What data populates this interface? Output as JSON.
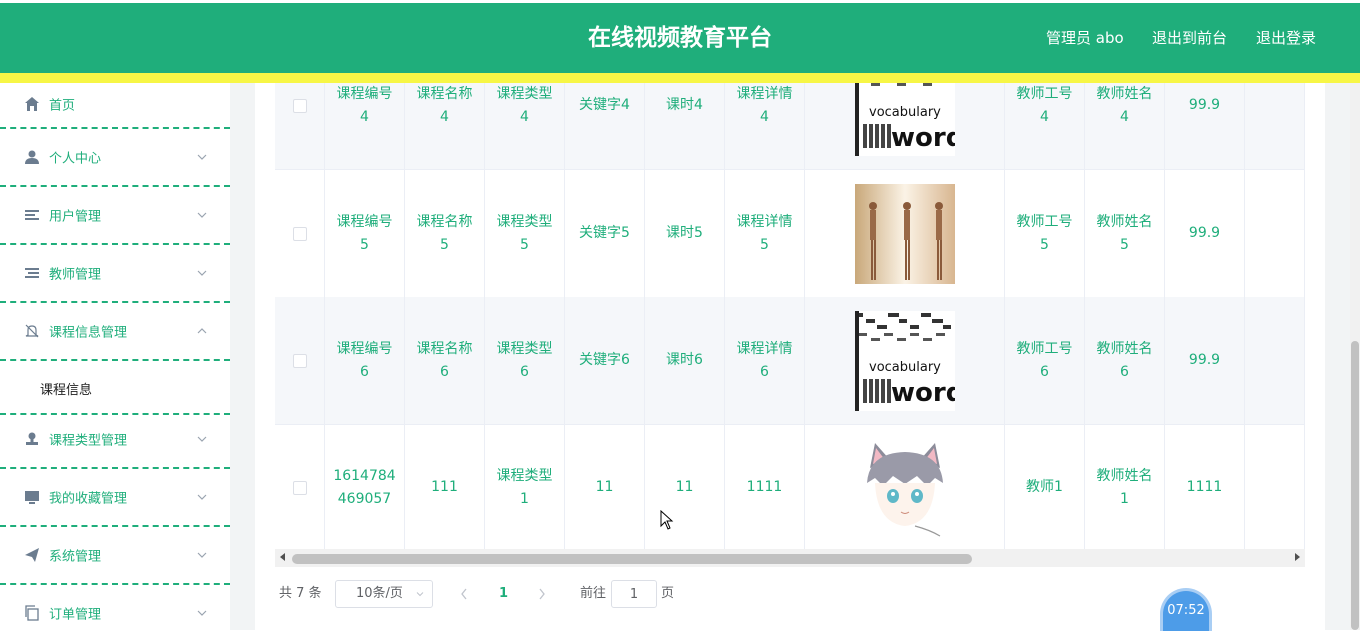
{
  "header": {
    "title": "在线视频教育平台",
    "admin_label": "管理员 abo",
    "front_label": "退出到前台",
    "logout_label": "退出登录",
    "colors": {
      "primary": "#1fae7b",
      "accent_strip": "#f7f646"
    }
  },
  "sidebar": {
    "items": [
      {
        "label": "首页",
        "icon": "home-icon"
      },
      {
        "label": "个人中心",
        "icon": "user-icon"
      },
      {
        "label": "用户管理",
        "icon": "list-icon"
      },
      {
        "label": "教师管理",
        "icon": "list-icon"
      },
      {
        "label": "课程信息管理",
        "icon": "bell-off-icon",
        "expanded": true
      },
      {
        "label": "课程信息",
        "sub": true
      },
      {
        "label": "课程类型管理",
        "icon": "stamp-icon"
      },
      {
        "label": "我的收藏管理",
        "icon": "monitor-icon"
      },
      {
        "label": "系统管理",
        "icon": "send-icon"
      },
      {
        "label": "订单管理",
        "icon": "copy-icon"
      }
    ]
  },
  "table": {
    "rows": [
      {
        "cells": [
          "课程编号\n4",
          "课程名称\n4",
          "课程类型\n4",
          "关键字4",
          "课时4",
          "课程详情\n4",
          "",
          "教师工号\n4",
          "教师姓名\n4",
          "99.9"
        ],
        "image": "words"
      },
      {
        "cells": [
          "课程编号\n5",
          "课程名称\n5",
          "课程类型\n5",
          "关键字5",
          "课时5",
          "课程详情\n5",
          "",
          "教师工号\n5",
          "教师姓名\n5",
          "99.9"
        ],
        "image": "yoga"
      },
      {
        "cells": [
          "课程编号\n6",
          "课程名称\n6",
          "课程类型\n6",
          "关键字6",
          "课时6",
          "课程详情\n6",
          "",
          "教师工号\n6",
          "教师姓名\n6",
          "99.9"
        ],
        "image": "words"
      },
      {
        "cells": [
          "1614784\n469057",
          "111",
          "课程类型\n1",
          "11",
          "11",
          "1111",
          "",
          "教师1",
          "教师姓名\n1",
          "1111"
        ],
        "image": "cat"
      }
    ]
  },
  "pagination": {
    "total": "共 7 条",
    "page_size": "10条/页",
    "current_page": "1",
    "goto_label": "前往",
    "goto_value": "1",
    "page_unit": "页"
  },
  "timer": "07:52"
}
